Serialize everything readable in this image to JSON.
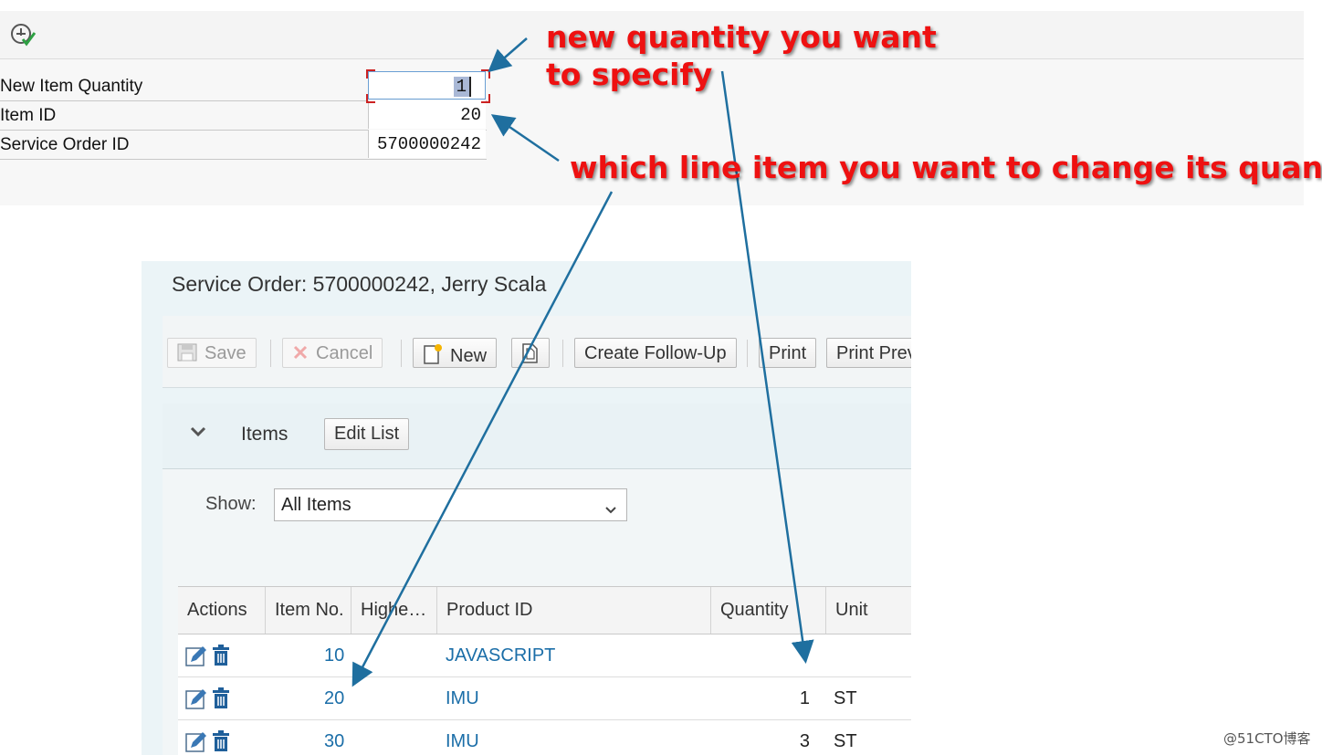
{
  "form": {
    "fields": [
      {
        "label": "New Item Quantity",
        "value": "1"
      },
      {
        "label": "Item ID",
        "value": "20"
      },
      {
        "label": "Service Order ID",
        "value": "5700000242"
      }
    ]
  },
  "annotations": {
    "quantity_line1": "new quantity you want",
    "quantity_line2": "to specify",
    "line_item": "which line item you want to change its quantity"
  },
  "web": {
    "title": "Service Order: 5700000242, Jerry Scala",
    "toolbar": {
      "save": "Save",
      "cancel": "Cancel",
      "new": "New",
      "create_follow_up": "Create Follow-Up",
      "print": "Print",
      "print_preview": "Print Prev"
    },
    "items": {
      "title": "Items",
      "edit_list": "Edit List",
      "show_label": "Show:",
      "show_value": "All Items",
      "columns": [
        "Actions",
        "Item No.",
        "Highe…",
        "Product ID",
        "Quantity",
        "Unit"
      ],
      "rows": [
        {
          "item_no": "10",
          "product_id": "JAVASCRIPT",
          "quantity": "",
          "unit": ""
        },
        {
          "item_no": "20",
          "product_id": "IMU",
          "quantity": "1",
          "unit": "ST"
        },
        {
          "item_no": "30",
          "product_id": "IMU",
          "quantity": "3",
          "unit": "ST"
        }
      ]
    }
  },
  "watermark": "@51CTO博客",
  "colors": {
    "annotation": "#ee1111",
    "arrow": "#1f6f9f",
    "link": "#1b6ea8"
  }
}
